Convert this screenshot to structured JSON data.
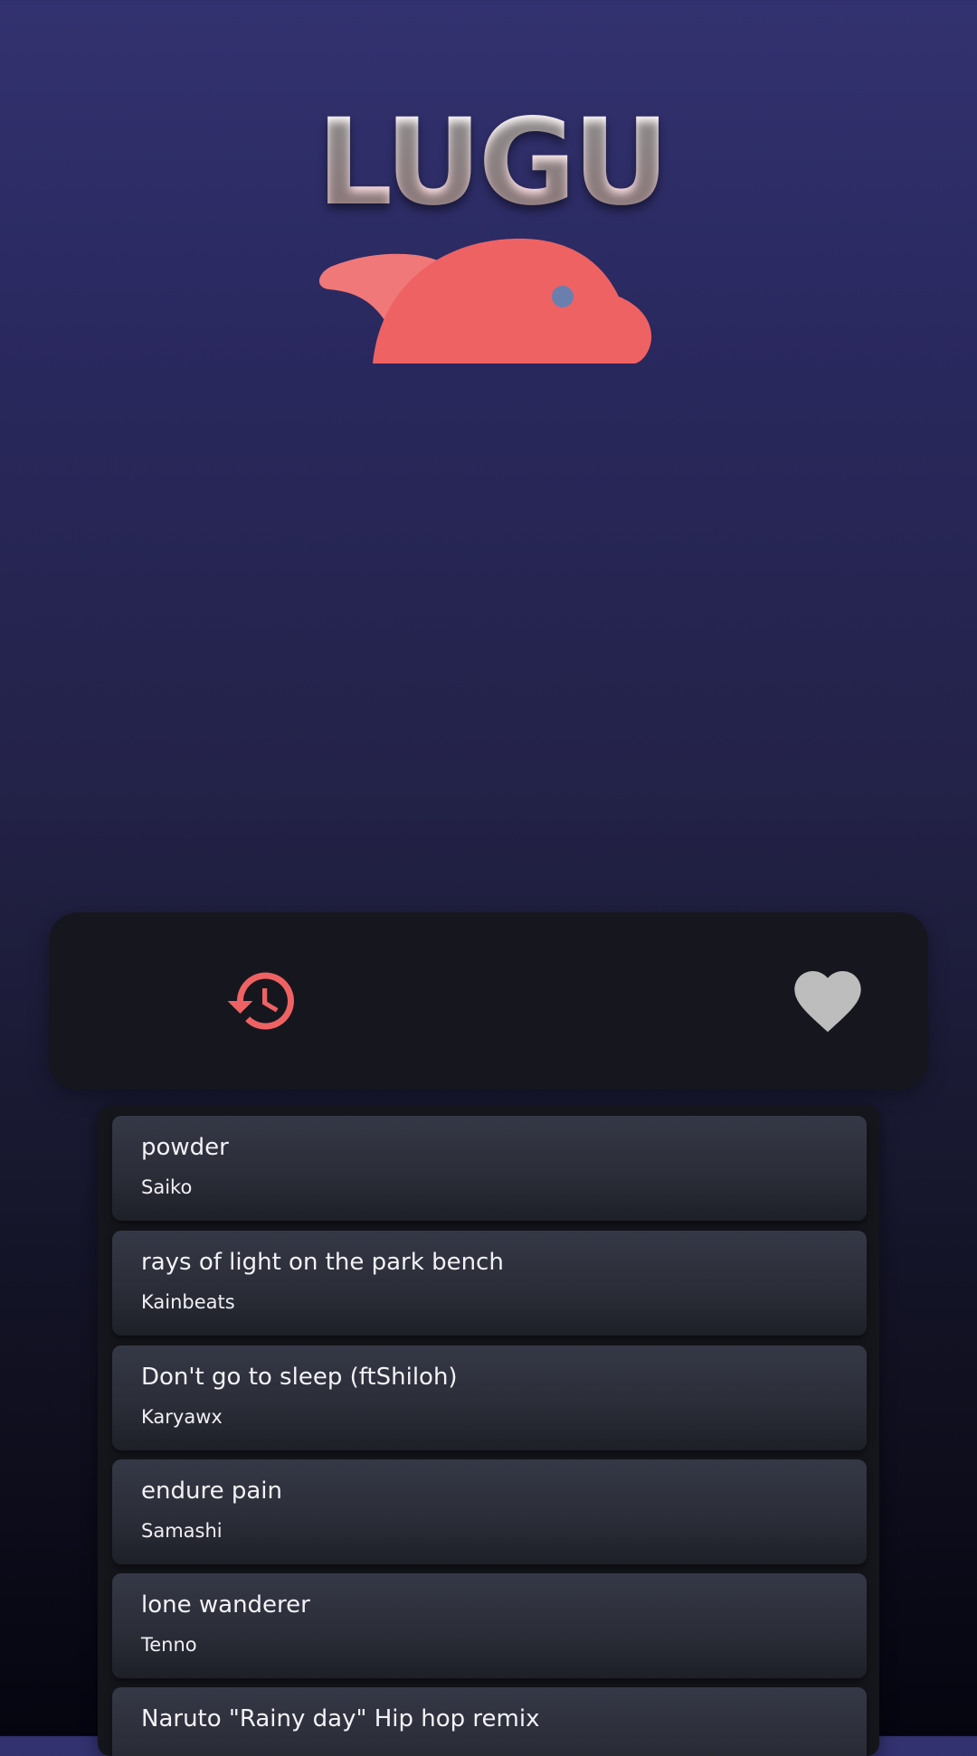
{
  "app": {
    "title": "LUGU"
  },
  "colors": {
    "background_top": "#333270",
    "background_bottom": "#050510",
    "accent": "#ef6263",
    "favorite_icon": "#bdbdbd",
    "panel": "#16171e",
    "card": "#2f313c"
  },
  "toolbar": {
    "history_icon": "history-icon",
    "favorites_icon": "heart-icon"
  },
  "tracks": [
    {
      "title": "powder",
      "artist": "Saiko"
    },
    {
      "title": "rays of light on the park bench",
      "artist": "Kainbeats"
    },
    {
      "title": "Don't go to sleep (ftShiloh)",
      "artist": "Karyawx"
    },
    {
      "title": "endure pain",
      "artist": "Samashi"
    },
    {
      "title": "lone wanderer",
      "artist": "Tenno"
    },
    {
      "title": "Naruto \"Rainy day\" Hip hop remix",
      "artist": ""
    }
  ]
}
